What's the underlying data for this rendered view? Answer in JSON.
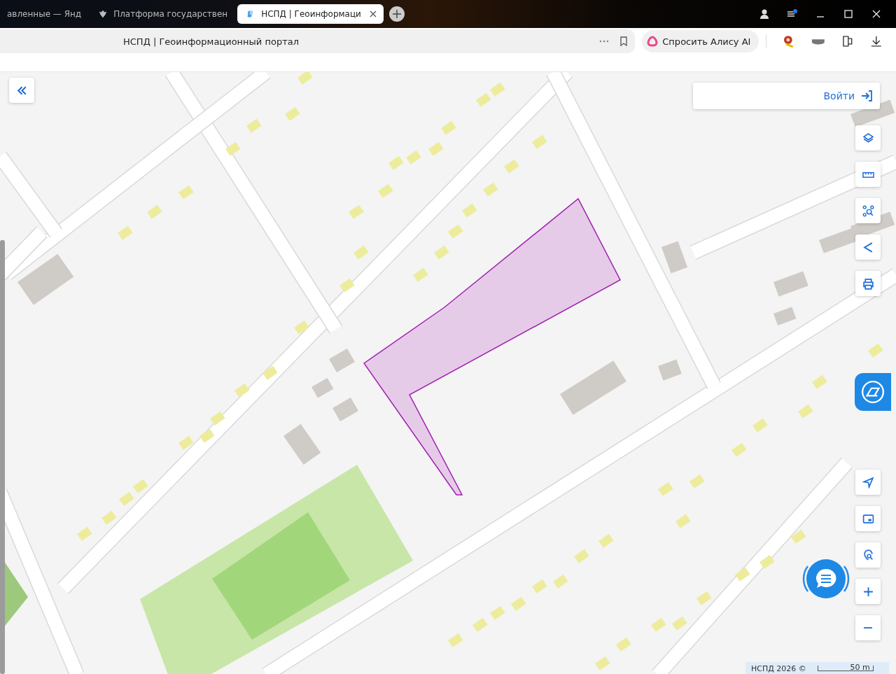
{
  "browser": {
    "tabs": [
      {
        "title": "авленные — Янд",
        "selected": false
      },
      {
        "title": "Платформа государствен",
        "selected": false
      },
      {
        "title": "НСПД | Геоинформаци",
        "selected": true
      }
    ],
    "address": {
      "title": "НСПД | Геоинформационный портал"
    },
    "alice_button": "Спросить Алису AI"
  },
  "map": {
    "login_button": "Войти",
    "attribution": "НСПД 2026 ©",
    "scale": "50 m"
  }
}
